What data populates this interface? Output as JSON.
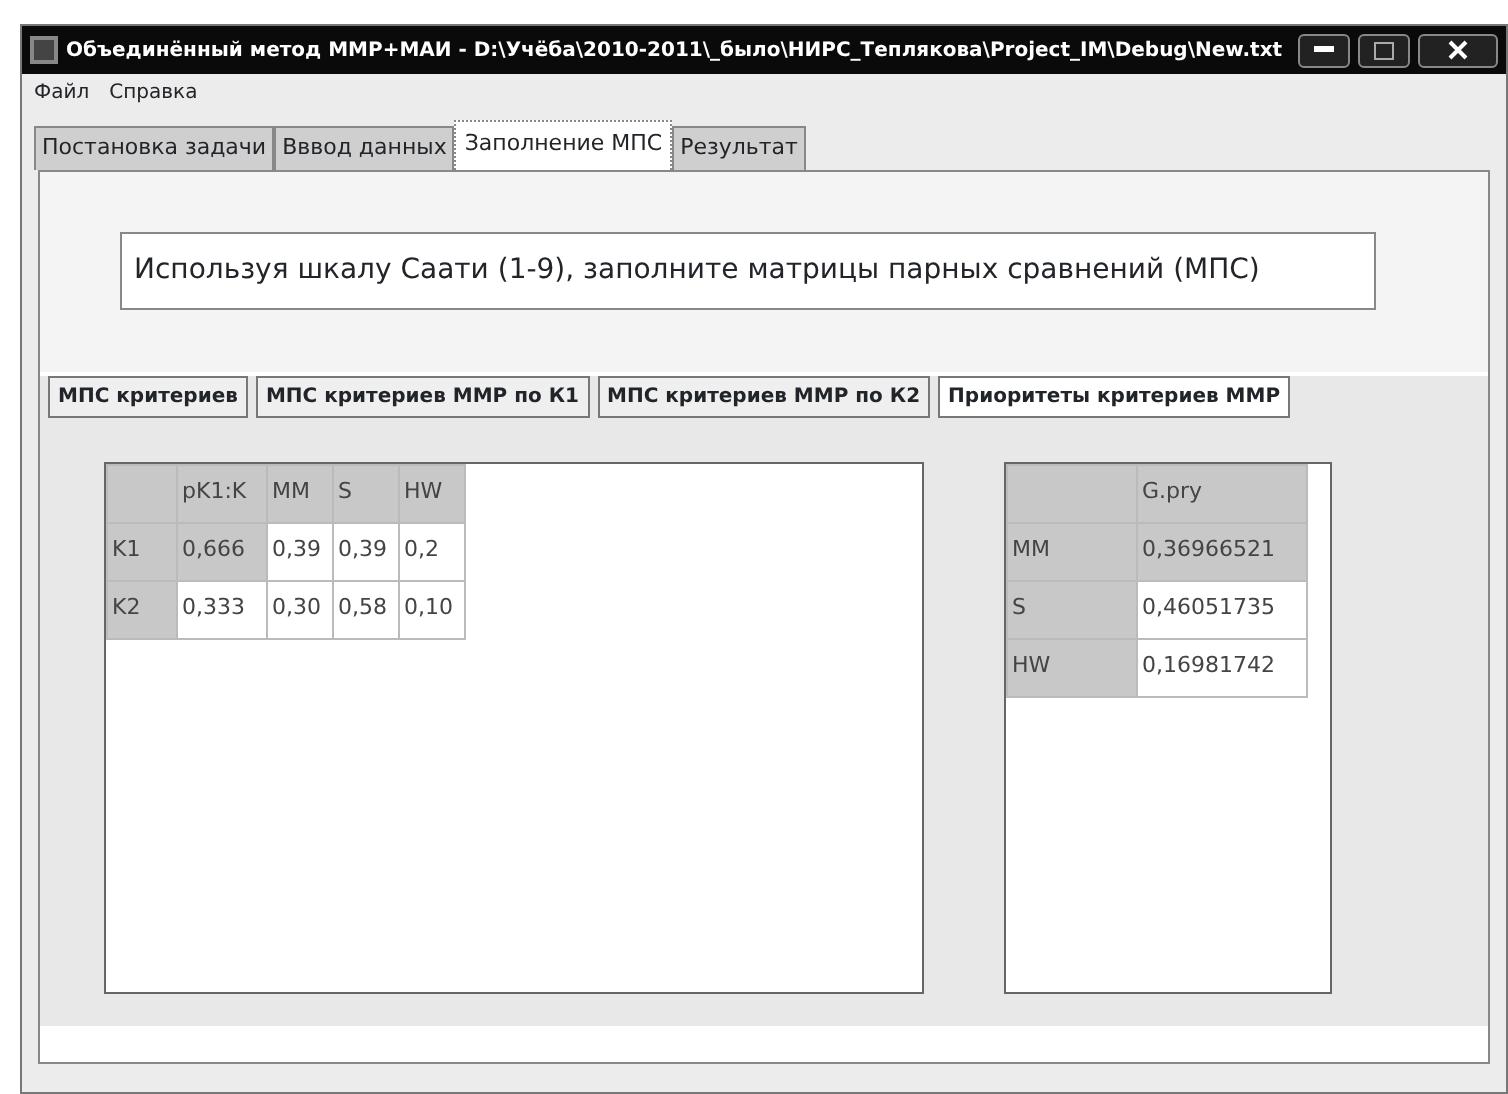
{
  "window": {
    "title": "Объединённый метод ММР+МАИ - D:\\Учёба\\2010-2011\\_было\\НИРС_Теплякова\\Project_IM\\Debug\\New.txt"
  },
  "menu": [
    "Файл",
    "Справка"
  ],
  "tabs": [
    {
      "label": "Постановка задачи",
      "selected": false
    },
    {
      "label": "Вввод данных",
      "selected": false
    },
    {
      "label": "Заполнение МПС",
      "selected": true
    },
    {
      "label": "Результат",
      "selected": false
    }
  ],
  "instruction": "Используя шкалу Саати (1-9), заполните матрицы парных сравнений (МПС)",
  "inner_tabs": [
    {
      "label": "МПС критериев",
      "selected": false
    },
    {
      "label": "МПС критериев ММР по К1",
      "selected": false
    },
    {
      "label": "МПС критериев ММР по К2",
      "selected": false
    },
    {
      "label": "Приоритеты критериев ММР",
      "selected": true
    }
  ],
  "grids": [
    {
      "columns": [
        "pK1:K",
        "MM",
        "S",
        "HW"
      ],
      "rows": [
        {
          "header": "K1",
          "cells": [
            {
              "text": "0,666",
              "selected": true
            },
            {
              "text": "0,39",
              "selected": false
            },
            {
              "text": "0,39",
              "selected": false
            },
            {
              "text": "0,2",
              "selected": false
            }
          ]
        },
        {
          "header": "K2",
          "cells": [
            {
              "text": "0,333",
              "selected": false
            },
            {
              "text": "0,30",
              "selected": false
            },
            {
              "text": "0,58",
              "selected": false
            },
            {
              "text": "0,10",
              "selected": false
            }
          ]
        }
      ]
    },
    {
      "columns": [
        "G.pry"
      ],
      "rows": [
        {
          "header": "MM",
          "cells": [
            {
              "text": "0,36966521",
              "selected": true
            }
          ]
        },
        {
          "header": "S",
          "cells": [
            {
              "text": "0,46051735",
              "selected": false
            }
          ]
        },
        {
          "header": "HW",
          "cells": [
            {
              "text": "0,16981742",
              "selected": false
            }
          ]
        }
      ]
    }
  ]
}
